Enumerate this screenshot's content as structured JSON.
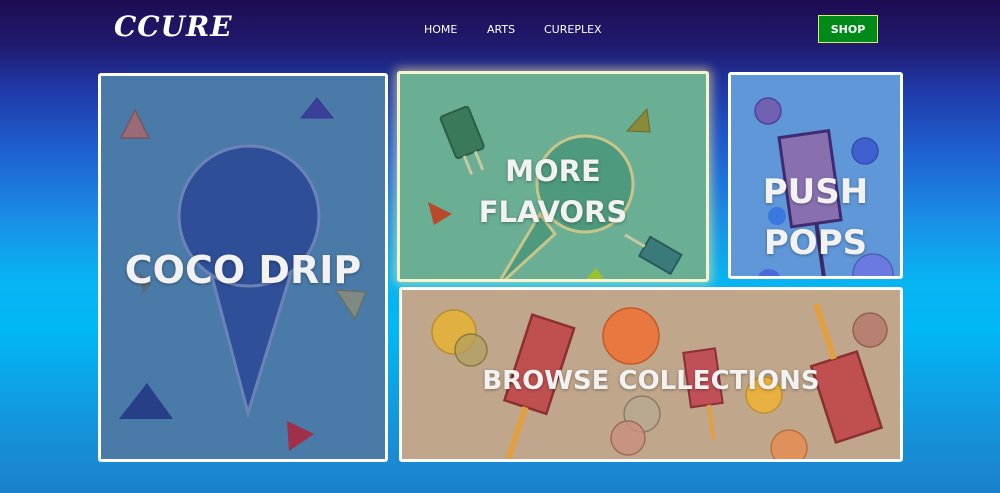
{
  "header": {
    "logo": "CCURE",
    "nav": [
      "HOME",
      "ARTS",
      "CUREPLEX"
    ],
    "shop_label": "SHOP"
  },
  "tiles": {
    "coco_drip": {
      "line1": "COCO DRIP"
    },
    "more_flavors": {
      "line1": "MORE",
      "line2": "FLAVORS"
    },
    "push_pops": {
      "line1": "PUSH",
      "line2": "POPS"
    },
    "browse": {
      "line1": "BROWSE COLLECTIONS"
    }
  },
  "colors": {
    "shop_button": "#008a1a",
    "coco_tile": "#4a7aa8",
    "flavors_tile": "#6aae94",
    "push_tile": "#5f97d8",
    "browse_tile": "#c0a68a"
  }
}
